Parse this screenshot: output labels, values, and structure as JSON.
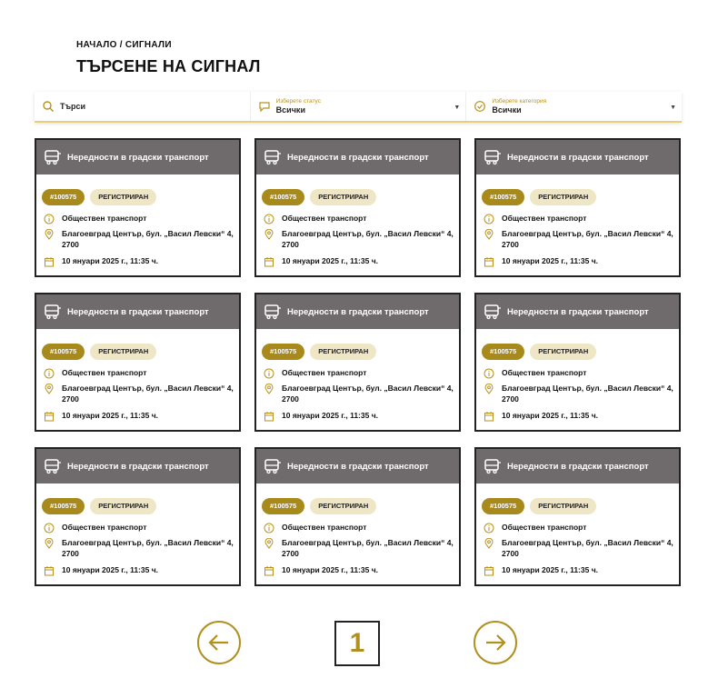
{
  "breadcrumb": "НАЧАЛО / СИГНАЛИ",
  "page_title": "ТЪРСЕНЕ НА СИГНАЛ",
  "filters": {
    "search_placeholder": "Търси",
    "status_label": "Изберете статус",
    "status_value": "Всички",
    "category_label": "Изберете категория",
    "category_value": "Всички"
  },
  "colors": {
    "accent": "#a8891c",
    "card_header": "#6f6a6b",
    "badge_status_bg": "#efe6c6"
  },
  "cards": [
    {
      "title": "Нередности в градски транспорт",
      "id": "#100575",
      "status": "РЕГИСТРИРАН",
      "category": "Обществен транспорт",
      "address": "Благоевград Център, бул. „Васил Левски“ 4, 2700",
      "date": "10 януари 2025 г., 11:35 ч."
    },
    {
      "title": "Нередности в градски транспорт",
      "id": "#100575",
      "status": "РЕГИСТРИРАН",
      "category": "Обществен транспорт",
      "address": "Благоевград Център, бул. „Васил Левски“ 4, 2700",
      "date": "10 януари 2025 г., 11:35 ч."
    },
    {
      "title": "Нередности в градски транспорт",
      "id": "#100575",
      "status": "РЕГИСТРИРАН",
      "category": "Обществен транспорт",
      "address": "Благоевград Център, бул. „Васил Левски“ 4, 2700",
      "date": "10 януари 2025 г., 11:35 ч."
    },
    {
      "title": "Нередности в градски транспорт",
      "id": "#100575",
      "status": "РЕГИСТРИРАН",
      "category": "Обществен транспорт",
      "address": "Благоевград Център, бул. „Васил Левски“ 4, 2700",
      "date": "10 януари 2025 г., 11:35 ч."
    },
    {
      "title": "Нередности в градски транспорт",
      "id": "#100575",
      "status": "РЕГИСТРИРАН",
      "category": "Обществен транспорт",
      "address": "Благоевград Център, бул. „Васил Левски“ 4, 2700",
      "date": "10 януари 2025 г., 11:35 ч."
    },
    {
      "title": "Нередности в градски транспорт",
      "id": "#100575",
      "status": "РЕГИСТРИРАН",
      "category": "Обществен транспорт",
      "address": "Благоевград Център, бул. „Васил Левски“ 4, 2700",
      "date": "10 януари 2025 г., 11:35 ч."
    },
    {
      "title": "Нередности в градски транспорт",
      "id": "#100575",
      "status": "РЕГИСТРИРАН",
      "category": "Обществен транспорт",
      "address": "Благоевград Център, бул. „Васил Левски“ 4, 2700",
      "date": "10 януари 2025 г., 11:35 ч."
    },
    {
      "title": "Нередности в градски транспорт",
      "id": "#100575",
      "status": "РЕГИСТРИРАН",
      "category": "Обществен транспорт",
      "address": "Благоевград Център, бул. „Васил Левски“ 4, 2700",
      "date": "10 януари 2025 г., 11:35 ч."
    },
    {
      "title": "Нередности в градски транспорт",
      "id": "#100575",
      "status": "РЕГИСТРИРАН",
      "category": "Обществен транспорт",
      "address": "Благоевград Център, бул. „Васил Левски“ 4, 2700",
      "date": "10 януари 2025 г., 11:35 ч."
    }
  ],
  "pagination": {
    "current_page": "1"
  }
}
